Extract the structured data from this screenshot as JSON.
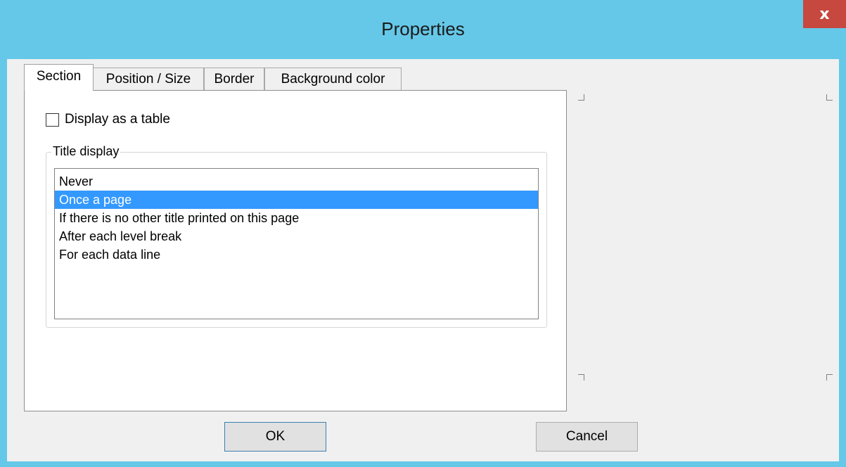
{
  "window": {
    "title": "Properties",
    "close_label": "x"
  },
  "tabs": [
    {
      "label": "Section",
      "active": true
    },
    {
      "label": "Position / Size",
      "active": false
    },
    {
      "label": "Border",
      "active": false
    },
    {
      "label": "Background color",
      "active": false
    }
  ],
  "section": {
    "checkbox_label": "Display as a table",
    "checkbox_checked": false,
    "group_title": "Title display",
    "options": [
      "Never",
      "Once a page",
      "If there is no other title printed on this page",
      "After each level break",
      "For each data line"
    ],
    "selected_option": "Once a page"
  },
  "buttons": {
    "ok": "OK",
    "cancel": "Cancel"
  },
  "colors": {
    "titlebar": "#65c8e8",
    "close": "#c7483f",
    "selection": "#3399ff"
  }
}
